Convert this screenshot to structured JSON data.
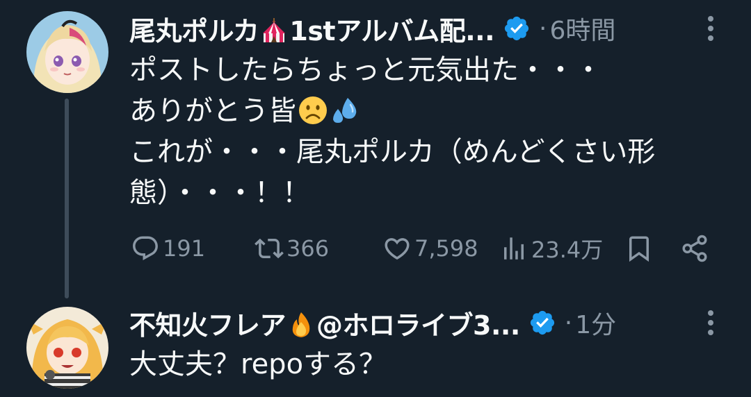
{
  "tweets": [
    {
      "author": {
        "name_part1": "尾丸ポルカ",
        "name_emoji": "circus-tent-emoji",
        "name_part2": "1stアルバム配...",
        "verified": true
      },
      "separator": "·",
      "time": "6時間",
      "lines": [
        "ポストしたらちょっと元気出た・・・",
        "ありがとう皆",
        "これが・・・尾丸ポルカ（めんどくさい形",
        "態）・・・！！"
      ],
      "line2_emojis": [
        "frowning-face-emoji",
        "sweat-droplets-emoji"
      ],
      "actions": {
        "replies": "191",
        "reposts": "366",
        "likes": "7,598",
        "views": "23.4万"
      }
    },
    {
      "author": {
        "name_part1": "不知火フレア",
        "name_emoji": "fire-emoji",
        "name_part2": "@ホロライブ3...",
        "verified": true
      },
      "separator": "·",
      "time": "1分",
      "lines": [
        "大丈夫？repoする？"
      ]
    }
  ],
  "colors": {
    "background": "#15202b",
    "text": "#f7f9f9",
    "muted": "#8b98a5",
    "verified": "#1d9bf0",
    "thread_line": "#3e4c5a"
  }
}
